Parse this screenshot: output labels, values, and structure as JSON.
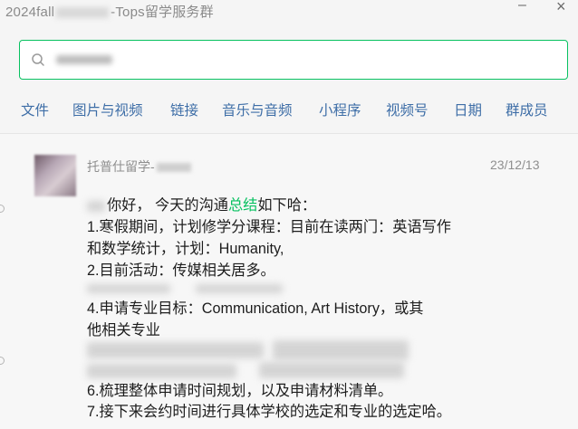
{
  "window": {
    "title_prefix": "2024fall",
    "title_suffix": "-Tops留学服务群",
    "minimize_glyph": "–",
    "close_glyph": "×"
  },
  "search": {
    "icon": "search-icon",
    "accent": "#07c160"
  },
  "tabs": [
    {
      "label": "文件"
    },
    {
      "label": "图片与视频"
    },
    {
      "label": "链接"
    },
    {
      "label": "音乐与音频"
    },
    {
      "label": "小程序"
    },
    {
      "label": "视频号"
    },
    {
      "label": "日期"
    },
    {
      "label": "群成员"
    }
  ],
  "message": {
    "sender": "托普仕留学-",
    "time": "23/12/13",
    "lines": [
      {
        "pre": "你好， 今天的沟通",
        "highlight": "总结",
        "post": "如下哈："
      },
      {
        "text": "1.寒假期间，计划修学分课程：目前在读两门：英语写作"
      },
      {
        "text": "和数学统计，计划：Humanity,"
      },
      {
        "text": "2.目前活动：传媒相关居多。"
      },
      {
        "text": "4.申请专业目标：Communication, Art History，或其"
      },
      {
        "text": "他相关专业"
      },
      {
        "text": "6.梳理整体申请时间规划，以及申请材料清单。"
      },
      {
        "text": "7.接下来会约时间进行具体学校的选定和专业的选定哈。"
      }
    ]
  },
  "colors": {
    "tab_text": "#3e6ea7",
    "highlight": "#07c160",
    "meta_text": "#8f8f8f"
  }
}
